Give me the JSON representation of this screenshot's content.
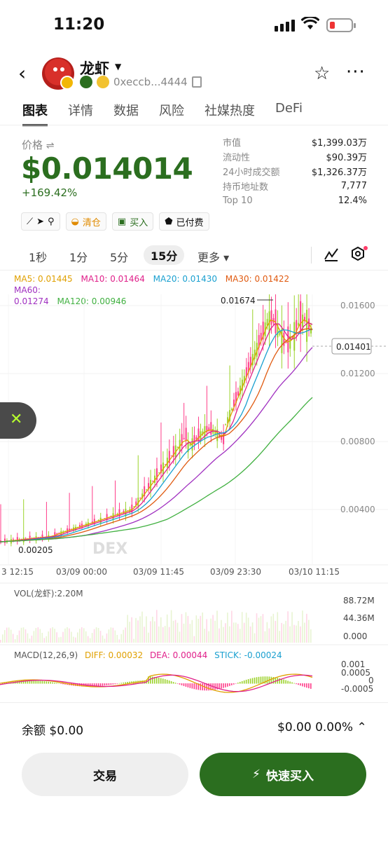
{
  "status_bar": {
    "time": "11:20"
  },
  "header": {
    "token_name": "龙虾",
    "address": "0xeccb...4444",
    "star_icon": "star-icon",
    "more_icon": "more-icon"
  },
  "tabs": [
    "图表",
    "详情",
    "数据",
    "风险",
    "社媒热度",
    "DeFi"
  ],
  "price": {
    "label": "价格",
    "value": "$0.014014",
    "change": "+169.42%"
  },
  "stats": [
    {
      "k": "市值",
      "v": "$1,399.03万"
    },
    {
      "k": "流动性",
      "v": "$90.39万"
    },
    {
      "k": "24小时成交额",
      "v": "$1,326.37万"
    },
    {
      "k": "持币地址数",
      "v": "7,777"
    },
    {
      "k": "Top 10",
      "v": "12.4%"
    }
  ],
  "tags": [
    "清仓",
    "买入",
    "已付费"
  ],
  "timeframes": [
    "1秒",
    "1分",
    "5分",
    "15分",
    "更多"
  ],
  "ma": {
    "ma5": "MA5: 0.01445",
    "ma10": "MA10: 0.01464",
    "ma20": "MA20: 0.01430",
    "ma30": "MA30: 0.01422",
    "ma60": "MA60:",
    "ma60_val": "0.01274",
    "ma120": "MA120: 0.00946"
  },
  "chart_data": {
    "type": "line",
    "y_ticks": [
      "0.01600",
      "0.01200",
      "0.00800",
      "0.00400"
    ],
    "x_ticks": [
      "3 12:15",
      "03/09 00:00",
      "03/09 11:45",
      "03/09 23:30",
      "03/10 11:15"
    ],
    "current_price_tag": "0.01401",
    "high_marker": "0.01674",
    "low_marker": "0.00205",
    "watermark": "DEX",
    "volume_label": "VOL(龙虾):2.20M",
    "volume_ticks": [
      "88.72M",
      "44.36M",
      "0.000"
    ],
    "macd_label": "MACD(12,26,9)",
    "macd_diff": "DIFF: 0.00032",
    "macd_dea": "DEA: 0.00044",
    "macd_stick": "STICK: -0.00024",
    "macd_ticks": [
      "0.001",
      "0.0005",
      "0",
      "-0.0005"
    ],
    "colors": {
      "ma5": "#e0a000",
      "ma10": "#e0208a",
      "ma20": "#1aa0d0",
      "ma30": "#e05a10",
      "ma60": "#a030c0",
      "ma120": "#40b040",
      "up": "#9bd22a",
      "down": "#ff3d8a"
    }
  },
  "footer": {
    "balance": "余额 $0.00",
    "balance_right": "$0.00 0.00%",
    "trade_button": "交易",
    "buy_button": "快速买入"
  }
}
